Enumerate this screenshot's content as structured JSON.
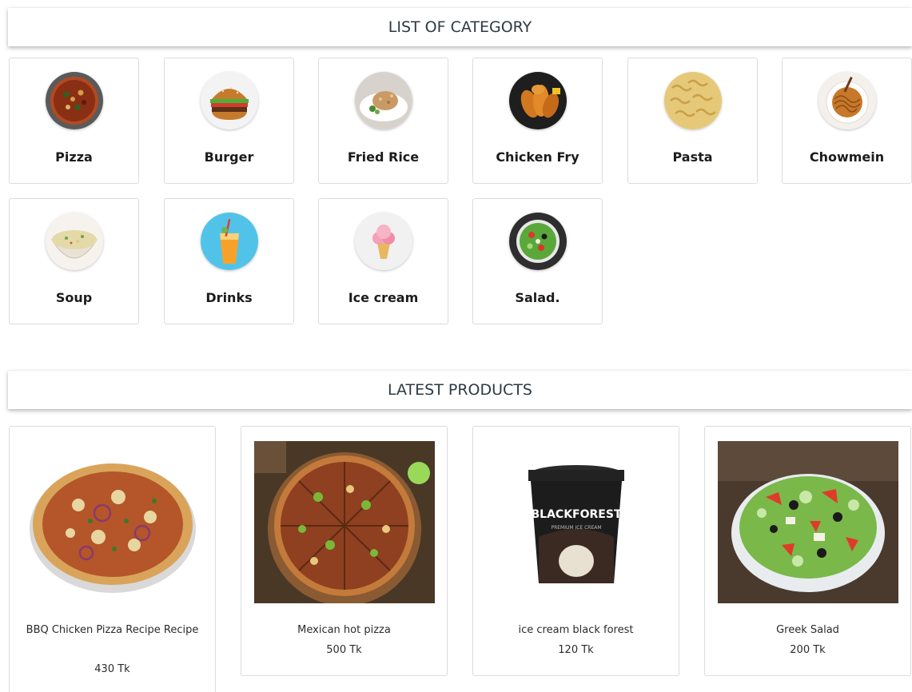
{
  "categories_section": {
    "title": "LIST OF CATEGORY",
    "items": [
      {
        "label": "Pizza",
        "icon": "pizza-icon"
      },
      {
        "label": "Burger",
        "icon": "burger-icon"
      },
      {
        "label": "Fried Rice",
        "icon": "fried-rice-icon"
      },
      {
        "label": "Chicken Fry",
        "icon": "chicken-fry-icon"
      },
      {
        "label": "Pasta",
        "icon": "pasta-icon"
      },
      {
        "label": "Chowmein",
        "icon": "chowmein-icon"
      },
      {
        "label": "Soup",
        "icon": "soup-icon"
      },
      {
        "label": "Drinks",
        "icon": "drinks-icon"
      },
      {
        "label": "Ice cream",
        "icon": "ice-cream-icon"
      },
      {
        "label": "Salad.",
        "icon": "salad-icon"
      }
    ]
  },
  "products_section": {
    "title": "LATEST PRODUCTS",
    "items": [
      {
        "name": "BBQ Chicken Pizza Recipe Recipe",
        "price": "430 Tk"
      },
      {
        "name": "Mexican hot pizza",
        "price": "500 Tk"
      },
      {
        "name": "ice cream black forest",
        "price": "120 Tk"
      },
      {
        "name": "Greek Salad",
        "price": "200 Tk"
      }
    ],
    "ice_cream_brand": "BLACKFOREST",
    "ice_cream_subtext": "PREMIUM ICE CREAM"
  },
  "colors": {
    "header_text": "#2c3a44",
    "card_border": "#dcdcdc",
    "label_text": "#1c1c1c"
  }
}
